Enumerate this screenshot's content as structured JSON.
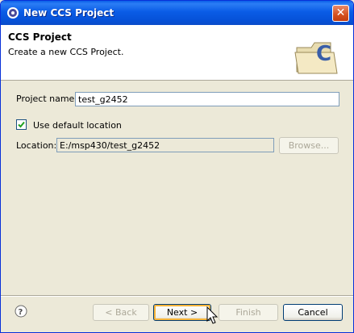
{
  "window": {
    "title": "New CCS Project",
    "close_label": "✕"
  },
  "header": {
    "title": "CCS Project",
    "description": "Create a new CCS Project."
  },
  "form": {
    "project_name_label": "Project name:",
    "project_name_value": "test_g2452",
    "use_default_label": "Use default location",
    "use_default_checked": true,
    "location_label": "Location:",
    "location_value": "E:/msp430/test_g2452",
    "browse_label": "Browse..."
  },
  "buttons": {
    "back": "< Back",
    "next": "Next >",
    "finish": "Finish",
    "cancel": "Cancel"
  },
  "icons": {
    "app": "eclipse-ccs-icon",
    "banner": "folder-with-c-icon",
    "help": "question-mark-icon",
    "cursor": "mouse-pointer-icon"
  }
}
